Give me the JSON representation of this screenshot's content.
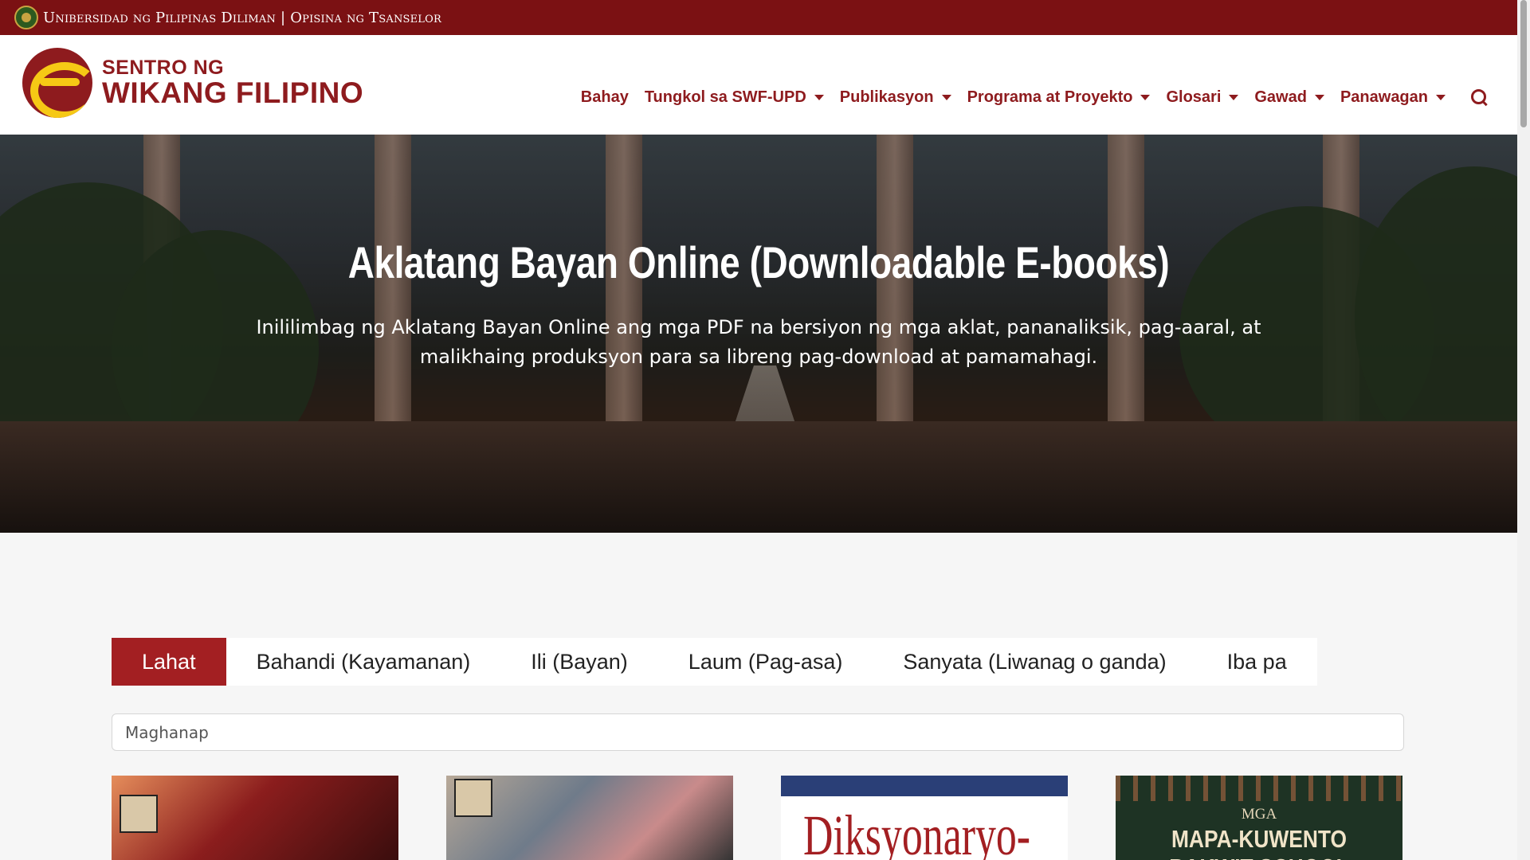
{
  "topbar": {
    "text": "Unibersidad ng Pilipinas Diliman | Opisina ng Tsanselor"
  },
  "logo": {
    "line1": "SENTRO NG",
    "line2": "WIKANG FILIPINO"
  },
  "nav": {
    "items": [
      {
        "label": "Bahay",
        "dropdown": false
      },
      {
        "label": "Tungkol sa SWF-UPD",
        "dropdown": true
      },
      {
        "label": "Publikasyon",
        "dropdown": true
      },
      {
        "label": "Programa at Proyekto",
        "dropdown": true
      },
      {
        "label": "Glosari",
        "dropdown": true
      },
      {
        "label": "Gawad",
        "dropdown": true
      },
      {
        "label": "Panawagan",
        "dropdown": true
      }
    ],
    "search_icon": "search-icon"
  },
  "hero": {
    "title": "Aklatang Bayan Online (Downloadable E-books)",
    "description": "Inililimbag ng Aklatang Bayan Online ang mga PDF na bersiyon ng mga aklat, pananaliksik, pag-aaral, at malikhaing produksyon para sa libreng pag-download at pamamahagi."
  },
  "filters": {
    "tabs": [
      {
        "label": "Lahat",
        "active": true
      },
      {
        "label": "Bahandi (Kayamanan)",
        "active": false
      },
      {
        "label": "Ili (Bayan)",
        "active": false
      },
      {
        "label": "Laum (Pag-asa)",
        "active": false
      },
      {
        "label": "Sanyata (Liwanag o ganda)",
        "active": false
      },
      {
        "label": "Iba pa",
        "active": false
      }
    ]
  },
  "search": {
    "placeholder": "Maghanap"
  },
  "cards": {
    "card3_title": "Diksyonaryo-",
    "card4_sub": "MGA",
    "card4_title": "MAPA-KUWENTO",
    "card4_title2": "BAKWIT SCHOOL"
  },
  "colors": {
    "brand": "#7b1113",
    "accent": "#a31f22",
    "gold": "#f6c915"
  }
}
